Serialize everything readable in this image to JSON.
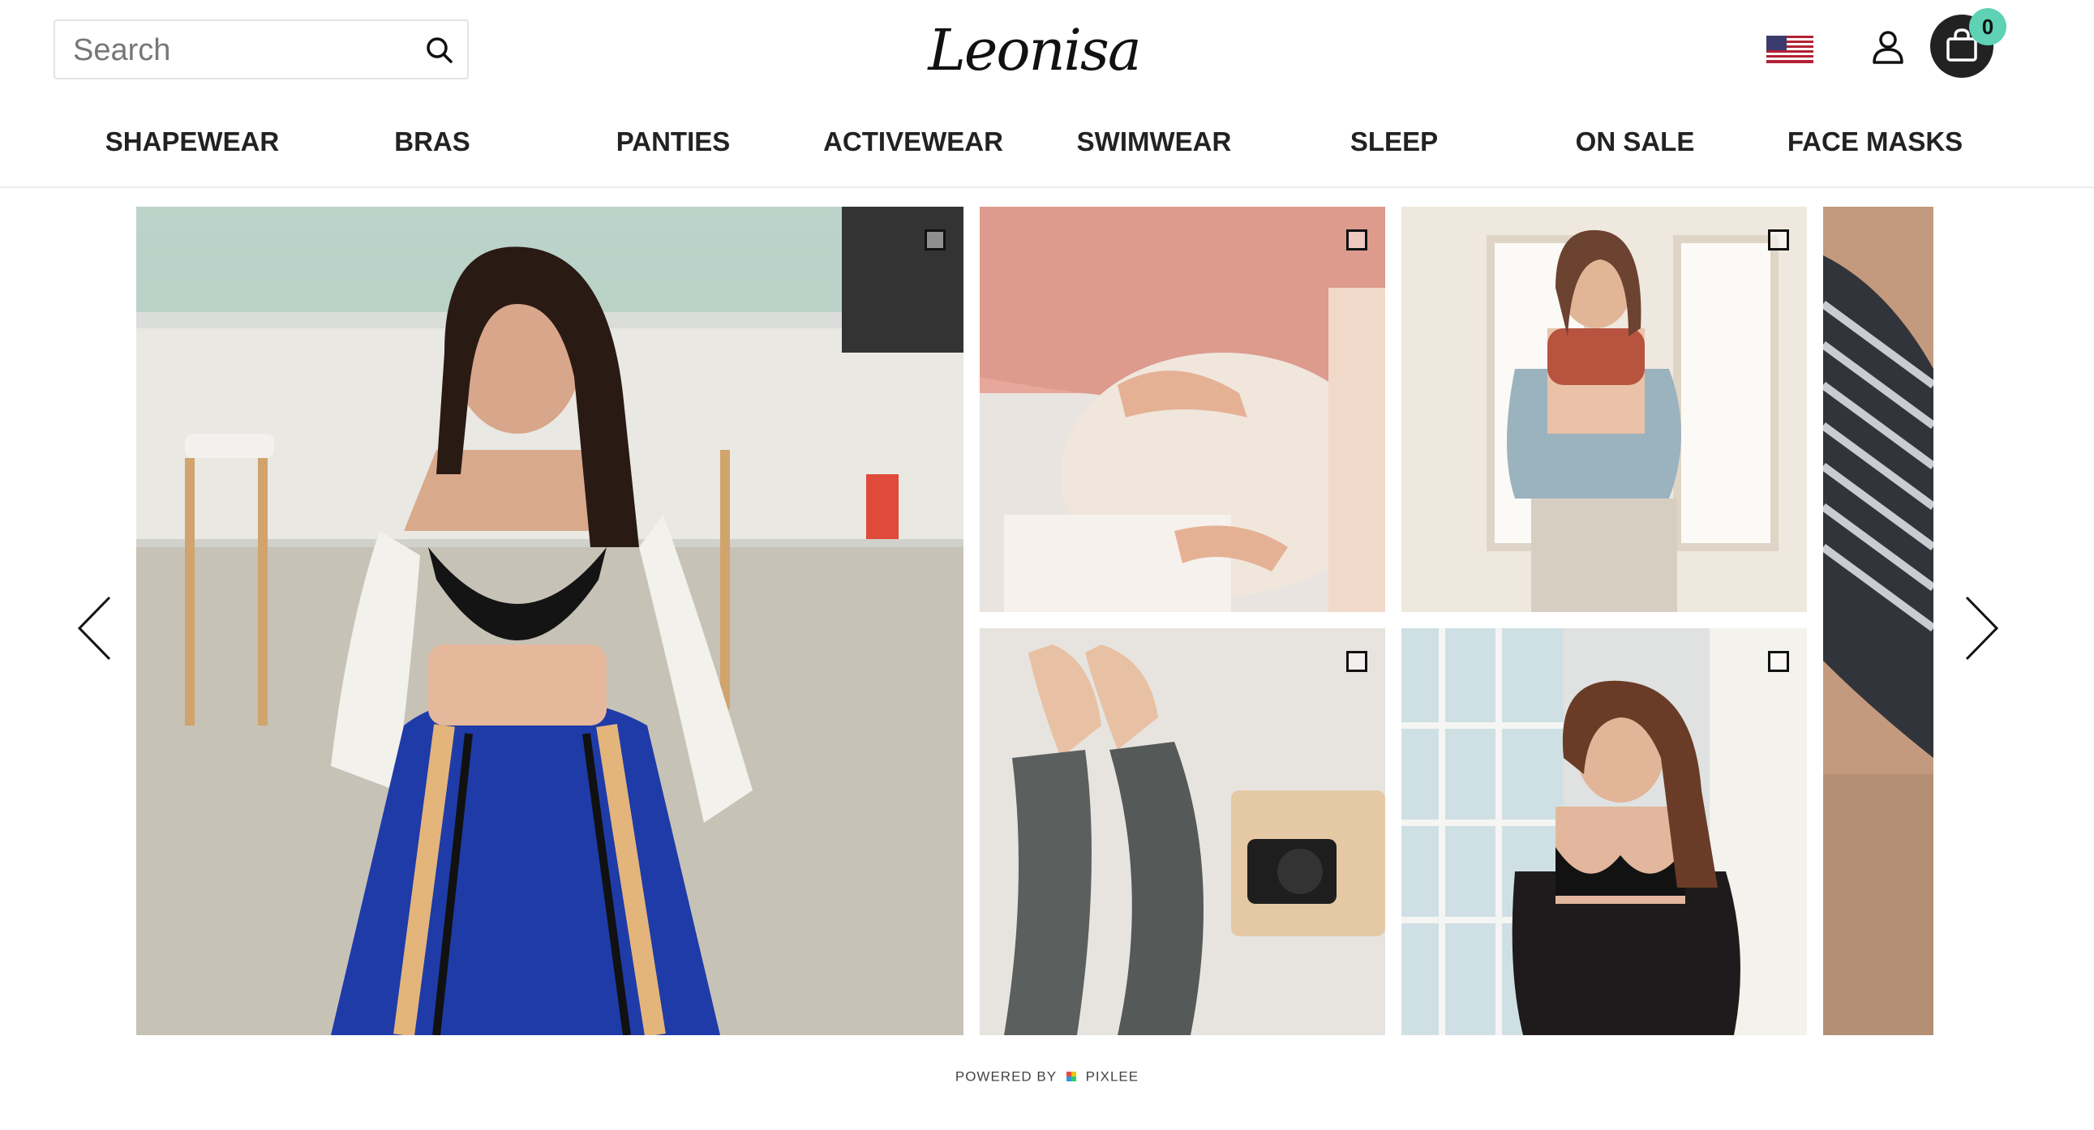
{
  "header": {
    "search": {
      "placeholder": "Search",
      "value": ""
    },
    "logo": "Leonisa",
    "flag": "us-flag-icon",
    "cart_count": "0"
  },
  "nav": {
    "items": [
      {
        "label": "SHAPEWEAR"
      },
      {
        "label": "BRAS"
      },
      {
        "label": "PANTIES"
      },
      {
        "label": "ACTIVEWEAR"
      },
      {
        "label": "SWIMWEAR"
      },
      {
        "label": "SLEEP"
      },
      {
        "label": "ON SALE"
      },
      {
        "label": "FACE MASKS"
      }
    ]
  },
  "gallery": {
    "photos": [
      {
        "subject": "woman-black-bralette-striped-pants"
      },
      {
        "subject": "maternity-belly-pink-sweater"
      },
      {
        "subject": "woman-rust-bralette-window"
      },
      {
        "subject": "legs-leggings-camera-bed"
      },
      {
        "subject": "woman-black-bra-floral-robe"
      },
      {
        "subject": "striped-shirt-partial"
      }
    ]
  },
  "footer": {
    "powered_by": "POWERED BY",
    "brand": "PIXLEE"
  },
  "colors": {
    "accent_badge": "#5fd1b4",
    "cart_bg": "#222222",
    "text": "#222222"
  }
}
